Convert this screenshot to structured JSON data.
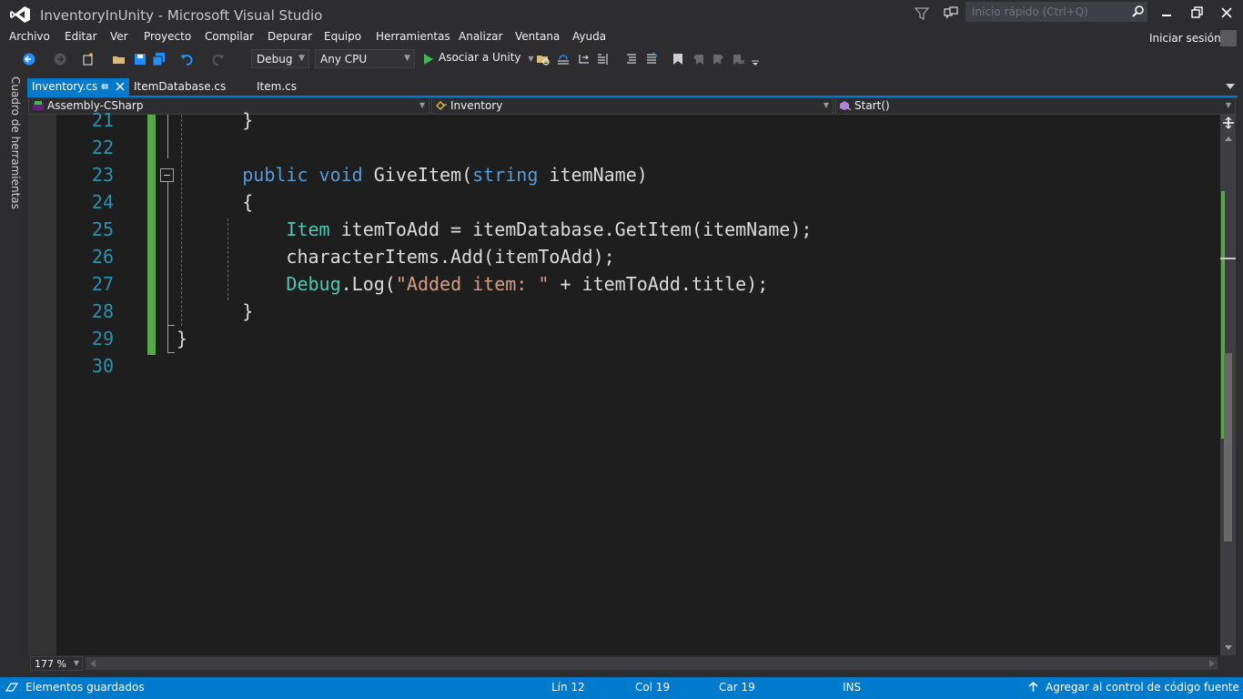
{
  "window": {
    "title": "InventoryInUnity - Microsoft Visual Studio",
    "quick_launch_placeholder": "Inicio rápido (Ctrl+Q)"
  },
  "menu": {
    "items": [
      "Archivo",
      "Editar",
      "Ver",
      "Proyecto",
      "Compilar",
      "Depurar",
      "Equipo",
      "Herramientas",
      "Analizar",
      "Ventana",
      "Ayuda"
    ],
    "signin": "Iniciar sesión"
  },
  "toolbar": {
    "configuration": "Debug",
    "platform": "Any CPU",
    "run_label": "Asociar a Unity"
  },
  "side_strip": {
    "label": "Cuadro de herramientas"
  },
  "tabs": [
    {
      "label": "Inventory.cs",
      "active": true
    },
    {
      "label": "ItemDatabase.cs",
      "active": false
    },
    {
      "label": "Item.cs",
      "active": false
    }
  ],
  "navbar": {
    "project": "Assembly-CSharp",
    "type": "Inventory",
    "member": "Start()"
  },
  "editor": {
    "line_numbers": [
      "21",
      "22",
      "23",
      "24",
      "25",
      "26",
      "27",
      "28",
      "29",
      "30"
    ],
    "lines": [
      {
        "indent": "      ",
        "parts": [
          {
            "t": "}",
            "c": ""
          }
        ]
      },
      {
        "indent": "",
        "parts": []
      },
      {
        "indent": "      ",
        "parts": [
          {
            "t": "public",
            "c": "kw"
          },
          {
            "t": " ",
            "c": ""
          },
          {
            "t": "void",
            "c": "kw"
          },
          {
            "t": " GiveItem(",
            "c": ""
          },
          {
            "t": "string",
            "c": "kw"
          },
          {
            "t": " itemName)",
            "c": ""
          }
        ]
      },
      {
        "indent": "      ",
        "parts": [
          {
            "t": "{",
            "c": ""
          }
        ]
      },
      {
        "indent": "          ",
        "parts": [
          {
            "t": "Item",
            "c": "ty"
          },
          {
            "t": " itemToAdd = itemDatabase.GetItem(itemName);",
            "c": ""
          }
        ]
      },
      {
        "indent": "          ",
        "parts": [
          {
            "t": "characterItems.Add(itemToAdd);",
            "c": ""
          }
        ]
      },
      {
        "indent": "          ",
        "parts": [
          {
            "t": "Debug",
            "c": "ty"
          },
          {
            "t": ".Log(",
            "c": ""
          },
          {
            "t": "\"Added item: \"",
            "c": "st"
          },
          {
            "t": " + itemToAdd.title);",
            "c": ""
          }
        ]
      },
      {
        "indent": "      ",
        "parts": [
          {
            "t": "}",
            "c": ""
          }
        ]
      },
      {
        "indent": "",
        "parts": [
          {
            "t": "}",
            "c": ""
          }
        ]
      },
      {
        "indent": "",
        "parts": []
      }
    ],
    "zoom": "177 %"
  },
  "status": {
    "message": "Elementos guardados",
    "line": "Lín 12",
    "col": "Col 19",
    "char": "Car 19",
    "mode": "INS",
    "source_control": "Agregar al control de código fuente"
  },
  "colors": {
    "accent": "#007acc",
    "keyword": "#569cd6",
    "type": "#4ec9b0",
    "string": "#d69d85",
    "line_number": "#2b91af",
    "change_marker": "#57a64a"
  }
}
